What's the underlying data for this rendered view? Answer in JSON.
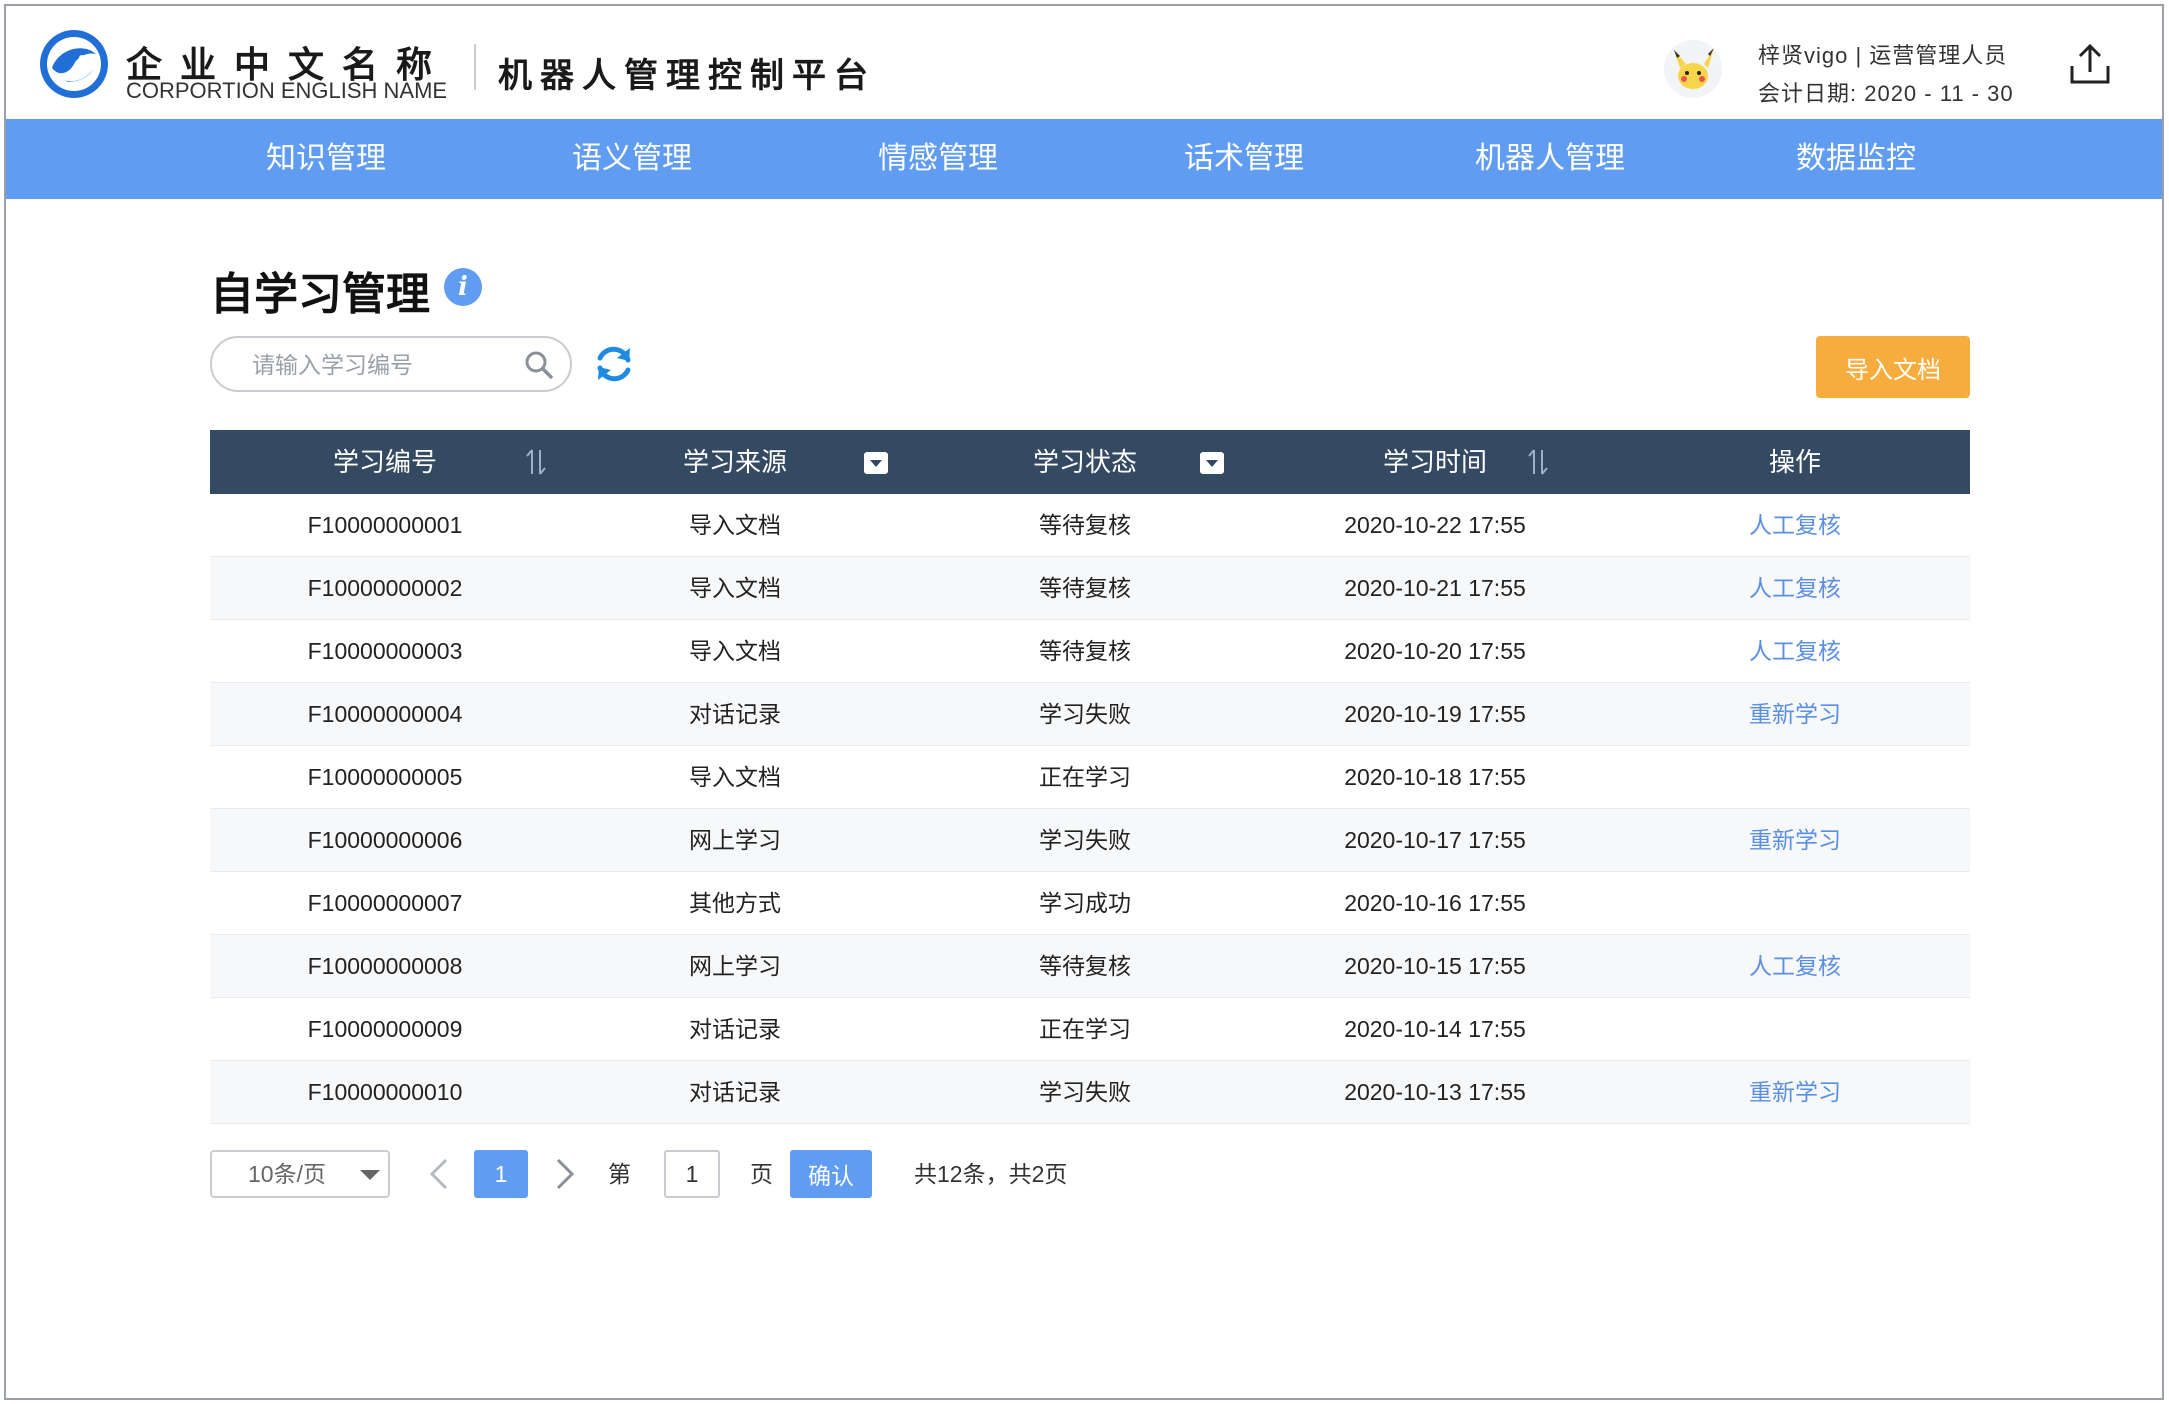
{
  "header": {
    "brand_cn": "企业中文名称",
    "brand_en": "CORPORTION ENGLISH NAME",
    "platform": "机器人管理控制平台",
    "user_line1": "梓贤vigo | 运营管理人员",
    "user_line2": "会计日期: 2020 - 11 - 30",
    "export_icon": "export-upload-icon"
  },
  "nav": {
    "items": [
      {
        "label": "知识管理"
      },
      {
        "label": "语义管理"
      },
      {
        "label": "情感管理"
      },
      {
        "label": "话术管理"
      },
      {
        "label": "机器人管理"
      },
      {
        "label": "数据监控"
      }
    ]
  },
  "page": {
    "title": "自学习管理",
    "info_glyph": "i"
  },
  "search": {
    "placeholder": "请输入学习编号",
    "value": ""
  },
  "toolbar": {
    "import_label": "导入文档"
  },
  "table": {
    "columns": [
      {
        "label": "学习编号",
        "control": "sort"
      },
      {
        "label": "学习来源",
        "control": "filter"
      },
      {
        "label": "学习状态",
        "control": "filter"
      },
      {
        "label": "学习时间",
        "control": "sort"
      },
      {
        "label": "操作",
        "control": "none"
      }
    ],
    "rows": [
      {
        "id": "F10000000001",
        "source": "导入文档",
        "status": "等待复核",
        "time": "2020-10-22 17:55",
        "action": "人工复核"
      },
      {
        "id": "F10000000002",
        "source": "导入文档",
        "status": "等待复核",
        "time": "2020-10-21 17:55",
        "action": "人工复核"
      },
      {
        "id": "F10000000003",
        "source": "导入文档",
        "status": "等待复核",
        "time": "2020-10-20 17:55",
        "action": "人工复核"
      },
      {
        "id": "F10000000004",
        "source": "对话记录",
        "status": "学习失败",
        "time": "2020-10-19 17:55",
        "action": "重新学习"
      },
      {
        "id": "F10000000005",
        "source": "导入文档",
        "status": "正在学习",
        "time": "2020-10-18 17:55",
        "action": ""
      },
      {
        "id": "F10000000006",
        "source": "网上学习",
        "status": "学习失败",
        "time": "2020-10-17 17:55",
        "action": "重新学习"
      },
      {
        "id": "F10000000007",
        "source": "其他方式",
        "status": "学习成功",
        "time": "2020-10-16 17:55",
        "action": ""
      },
      {
        "id": "F10000000008",
        "source": "网上学习",
        "status": "等待复核",
        "time": "2020-10-15 17:55",
        "action": "人工复核"
      },
      {
        "id": "F10000000009",
        "source": "对话记录",
        "status": "正在学习",
        "time": "2020-10-14 17:55",
        "action": ""
      },
      {
        "id": "F10000000010",
        "source": "对话记录",
        "status": "学习失败",
        "time": "2020-10-13 17:55",
        "action": "重新学习"
      }
    ]
  },
  "pagination": {
    "page_size": "10条/页",
    "current_page": "1",
    "goto_prefix": "第",
    "goto_value": "1",
    "goto_suffix": "页",
    "confirm_label": "确认",
    "total_text": "共12条，共2页"
  },
  "colors": {
    "nav_bg": "#5f9cf2",
    "table_header_bg": "#344962",
    "import_button": "#f7ad3e",
    "link": "#5b8fe0"
  }
}
